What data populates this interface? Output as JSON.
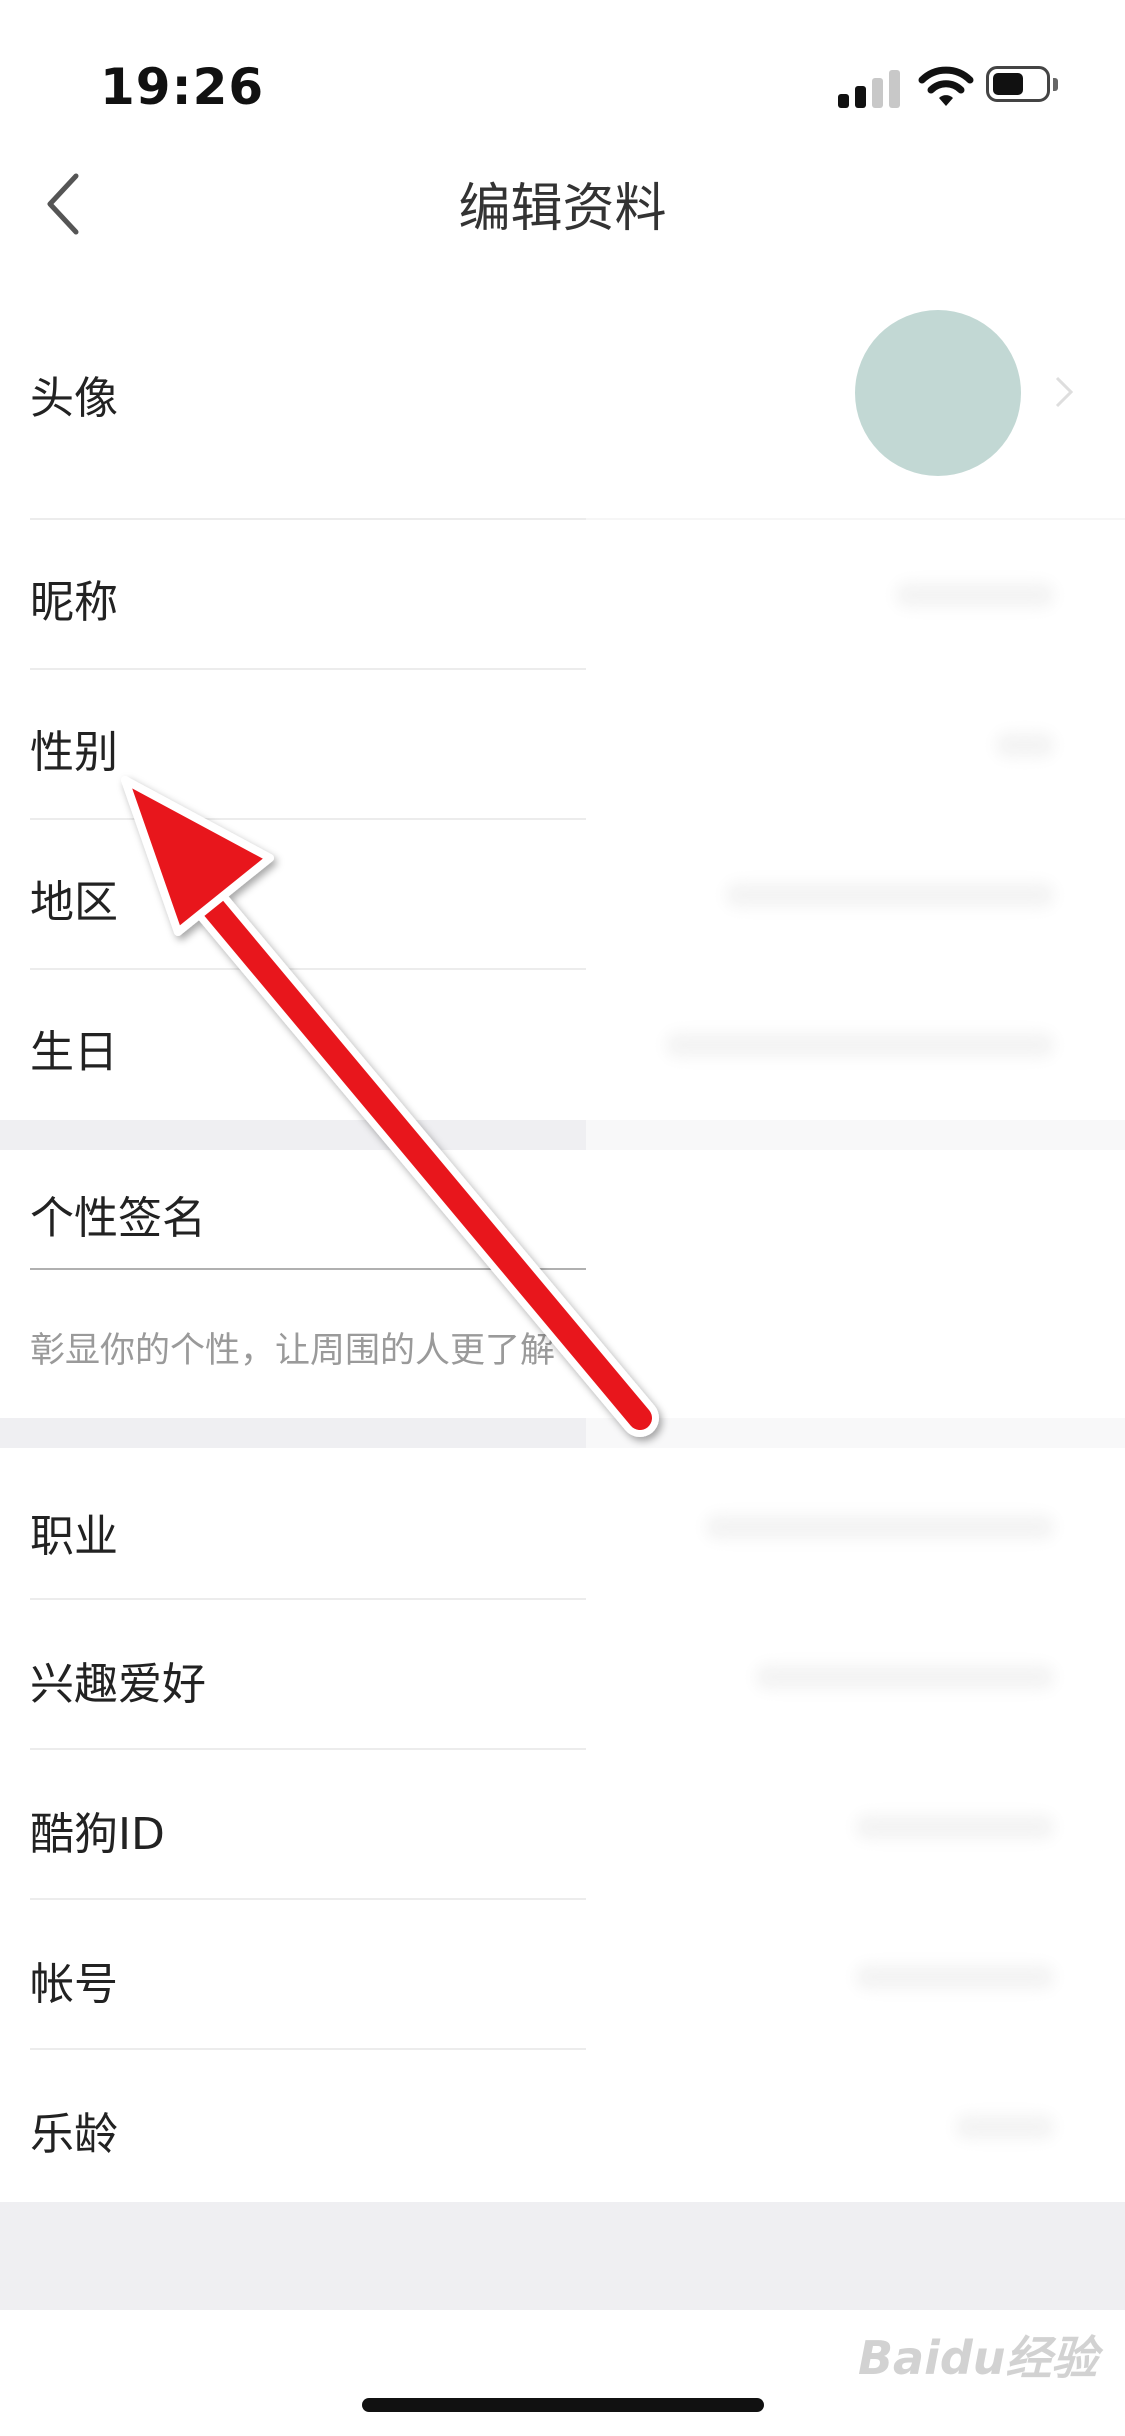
{
  "status_bar": {
    "time": "19:26"
  },
  "nav": {
    "title": "编辑资料"
  },
  "profile": {
    "avatar_label": "头像",
    "nickname_label": "昵称",
    "gender_label": "性别",
    "region_label": "地区",
    "birthday_label": "生日",
    "signature_label": "个性签名",
    "signature_placeholder": "彰显你的个性，让周围的人更了解",
    "occupation_label": "职业",
    "hobbies_label": "兴趣爱好",
    "kugou_id_label": "酷狗ID",
    "account_label": "帐号",
    "music_age_label": "乐龄"
  },
  "watermark": "Baidu经验",
  "colors": {
    "avatar": "#78a9a0",
    "annotation_arrow": "#e8141b"
  }
}
